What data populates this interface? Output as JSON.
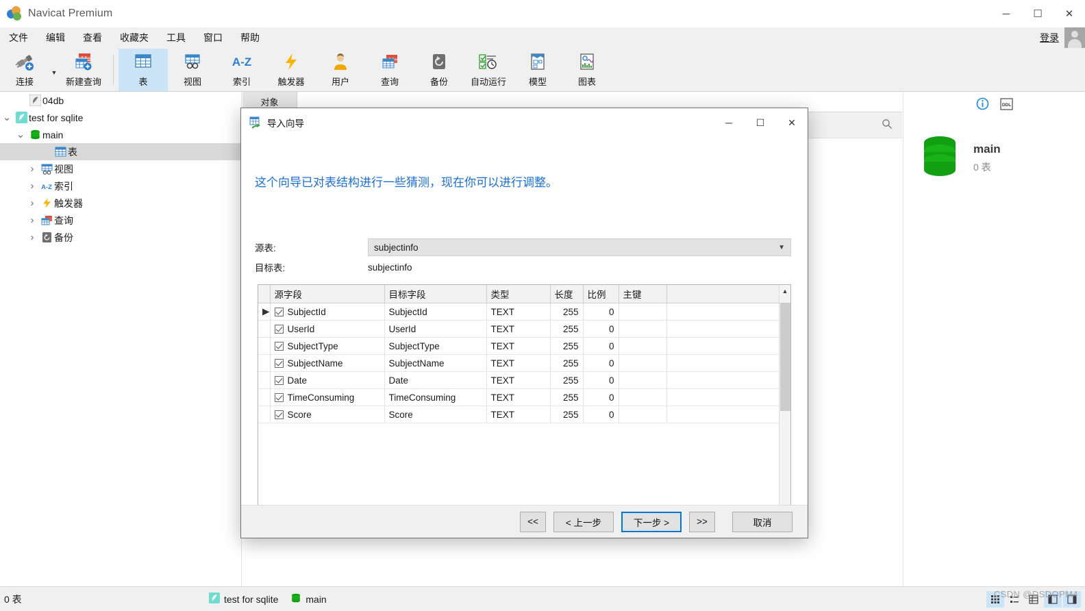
{
  "window": {
    "title": "Navicat Premium",
    "minimize": "─",
    "maximize": "☐",
    "close": "✕"
  },
  "menubar": {
    "items": [
      "文件",
      "编辑",
      "查看",
      "收藏夹",
      "工具",
      "窗口",
      "帮助"
    ],
    "login_label": "登录"
  },
  "toolbar": {
    "items": [
      {
        "label": "连接",
        "icon": "connection-icon"
      },
      {
        "label": "新建查询",
        "icon": "new-query-icon"
      },
      {
        "label": "表",
        "icon": "table-icon",
        "active": true
      },
      {
        "label": "视图",
        "icon": "view-icon"
      },
      {
        "label": "索引",
        "icon": "index-icon"
      },
      {
        "label": "触发器",
        "icon": "trigger-icon"
      },
      {
        "label": "用户",
        "icon": "user-icon"
      },
      {
        "label": "查询",
        "icon": "query-icon"
      },
      {
        "label": "备份",
        "icon": "backup-icon"
      },
      {
        "label": "自动运行",
        "icon": "automation-icon"
      },
      {
        "label": "模型",
        "icon": "model-icon"
      },
      {
        "label": "图表",
        "icon": "chart-icon"
      }
    ]
  },
  "sidebar": {
    "items": [
      {
        "label": "04db",
        "indent": 1,
        "twisty": "none",
        "icon": "sqlite-feather-icon",
        "selected": false
      },
      {
        "label": "test for sqlite",
        "indent": 0,
        "twisty": "open",
        "icon": "sqlite-feather-icon",
        "selected": false
      },
      {
        "label": "main",
        "indent": 1,
        "twisty": "open",
        "icon": "database-icon",
        "selected": false
      },
      {
        "label": "表",
        "indent": 3,
        "twisty": "none",
        "icon": "table-icon",
        "selected": true
      },
      {
        "label": "视图",
        "indent": 2,
        "twisty": "closed",
        "icon": "view-icon",
        "selected": false
      },
      {
        "label": "索引",
        "indent": 2,
        "twisty": "closed",
        "icon": "index-icon",
        "selected": false
      },
      {
        "label": "触发器",
        "indent": 2,
        "twisty": "closed",
        "icon": "trigger-icon",
        "selected": false
      },
      {
        "label": "查询",
        "indent": 2,
        "twisty": "closed",
        "icon": "query-icon",
        "selected": false
      },
      {
        "label": "备份",
        "indent": 2,
        "twisty": "closed",
        "icon": "backup-icon",
        "selected": false
      }
    ]
  },
  "content": {
    "tab_label": "对象",
    "search_icon": "search-icon"
  },
  "rightpanel": {
    "info_icon": "info-icon",
    "ddl_icon": "ddl-icon",
    "ddl_text": "DDL",
    "db_name": "main",
    "db_sub": "0 表"
  },
  "statusbar": {
    "left": "0 表",
    "connection": "test for sqlite",
    "database": "main",
    "watermark": "CSDN @DSDOPM4"
  },
  "dialog": {
    "title": "导入向导",
    "title_icon": "import-wizard-icon",
    "minimize": "─",
    "maximize": "☐",
    "close": "✕",
    "headline": "这个向导已对表结构进行一些猜测，现在你可以进行调整。",
    "source_table_label": "源表:",
    "source_table_value": "subjectinfo",
    "target_table_label": "目标表:",
    "target_table_value": "subjectinfo",
    "grid": {
      "columns": [
        "",
        "源字段",
        "目标字段",
        "类型",
        "长度",
        "比例",
        "主键"
      ],
      "rows": [
        {
          "current": true,
          "checked": true,
          "source": "SubjectId",
          "target": "SubjectId",
          "type": "TEXT",
          "length": "255",
          "scale": "0",
          "pk": ""
        },
        {
          "current": false,
          "checked": true,
          "source": "UserId",
          "target": "UserId",
          "type": "TEXT",
          "length": "255",
          "scale": "0",
          "pk": ""
        },
        {
          "current": false,
          "checked": true,
          "source": "SubjectType",
          "target": "SubjectType",
          "type": "TEXT",
          "length": "255",
          "scale": "0",
          "pk": ""
        },
        {
          "current": false,
          "checked": true,
          "source": "SubjectName",
          "target": "SubjectName",
          "type": "TEXT",
          "length": "255",
          "scale": "0",
          "pk": ""
        },
        {
          "current": false,
          "checked": true,
          "source": "Date",
          "target": "Date",
          "type": "TEXT",
          "length": "255",
          "scale": "0",
          "pk": ""
        },
        {
          "current": false,
          "checked": true,
          "source": "TimeConsuming",
          "target": "TimeConsuming",
          "type": "TEXT",
          "length": "255",
          "scale": "0",
          "pk": ""
        },
        {
          "current": false,
          "checked": true,
          "source": "Score",
          "target": "Score",
          "type": "TEXT",
          "length": "255",
          "scale": "0",
          "pk": ""
        }
      ]
    },
    "buttons": {
      "first": "<<",
      "prev": "< 上一步",
      "next": "下一步 >",
      "last": ">>",
      "cancel": "取消"
    }
  },
  "colors": {
    "accent": "#0078d7",
    "headline": "#1a6fd4",
    "toolbar_active": "#cce4f7",
    "db_green": "#12a012",
    "select_gray": "#d9d9d9"
  }
}
